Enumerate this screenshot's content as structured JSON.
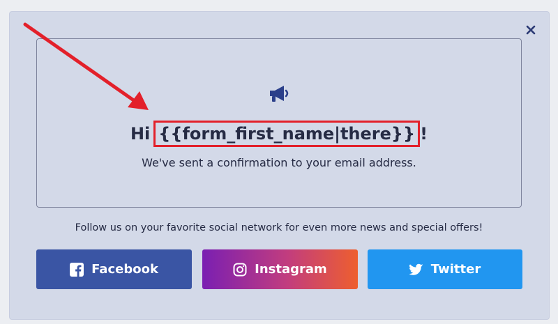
{
  "modal": {
    "close_icon": "close-icon",
    "megaphone_icon": "megaphone-icon",
    "greeting_prefix": "Hi",
    "greeting_placeholder": "{{form_first_name|there}}",
    "greeting_suffix": "!",
    "confirmation": "We've sent a confirmation to your email address.",
    "follow_text": "Follow us on your favorite social network for even more news and special offers!"
  },
  "social": {
    "facebook": {
      "label": "Facebook",
      "icon": "facebook-icon",
      "color": "#3a55a4"
    },
    "instagram": {
      "label": "Instagram",
      "icon": "instagram-icon",
      "colors": [
        "#7a1fb2",
        "#ee5f2e"
      ]
    },
    "twitter": {
      "label": "Twitter",
      "icon": "twitter-icon",
      "color": "#2196f0"
    }
  },
  "annotation": {
    "arrow_color": "#e3202a",
    "highlight_color": "#e3202a"
  }
}
